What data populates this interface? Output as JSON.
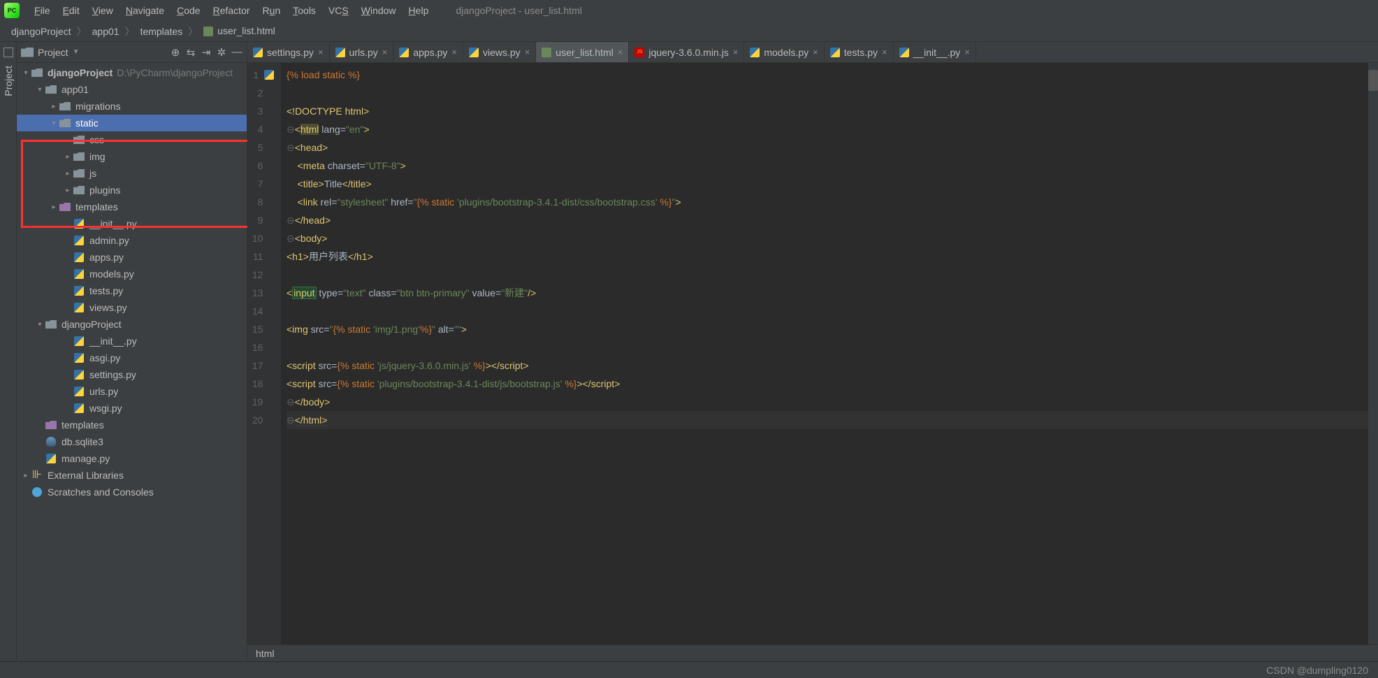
{
  "window_title": "djangoProject - user_list.html",
  "menus": [
    "File",
    "Edit",
    "View",
    "Navigate",
    "Code",
    "Refactor",
    "Run",
    "Tools",
    "VCS",
    "Window",
    "Help"
  ],
  "breadcrumbs": [
    "djangoProject",
    "app01",
    "templates",
    "user_list.html"
  ],
  "project_panel": {
    "title": "Project"
  },
  "tree": {
    "root": {
      "name": "djangoProject",
      "path": "D:\\PyCharm\\djangoProject"
    },
    "app01": "app01",
    "migrations": "migrations",
    "static": "static",
    "static_children": [
      "css",
      "img",
      "js",
      "plugins"
    ],
    "templates_inner": "templates",
    "app_files": [
      "__init__.py",
      "admin.py",
      "apps.py",
      "models.py",
      "tests.py",
      "views.py"
    ],
    "proj_pkg": "djangoProject",
    "proj_files": [
      "__init__.py",
      "asgi.py",
      "settings.py",
      "urls.py",
      "wsgi.py"
    ],
    "templates_top": "templates",
    "db": "db.sqlite3",
    "manage": "manage.py",
    "ext_lib": "External Libraries",
    "scratch": "Scratches and Consoles"
  },
  "tabs": [
    {
      "label": "settings.py",
      "type": "py"
    },
    {
      "label": "urls.py",
      "type": "py"
    },
    {
      "label": "apps.py",
      "type": "py"
    },
    {
      "label": "views.py",
      "type": "py"
    },
    {
      "label": "user_list.html",
      "type": "html",
      "active": true
    },
    {
      "label": "jquery-3.6.0.min.js",
      "type": "js"
    },
    {
      "label": "models.py",
      "type": "py"
    },
    {
      "label": "tests.py",
      "type": "py"
    },
    {
      "label": "__init__.py",
      "type": "py"
    }
  ],
  "code": {
    "l1": "{% load static %}",
    "l3": "<!DOCTYPE html>",
    "l4_a": "<",
    "l4_tag": "html",
    "l4_b": " lang=",
    "l4_str": "\"en\"",
    "l4_c": ">",
    "l5": "<head>",
    "l6_a": "    <",
    "l6_tag": "meta",
    "l6_b": " charset=",
    "l6_str": "\"UTF-8\"",
    "l6_c": ">",
    "l7_a": "    <",
    "l7_tag": "title",
    "l7_b": ">Title</",
    "l7_tag2": "title",
    "l7_c": ">",
    "l8_a": "    <",
    "l8_tag": "link",
    "l8_b": " rel=",
    "l8_s1": "\"stylesheet\"",
    "l8_c": " href=",
    "l8_s2": "\"{% static ",
    "l8_s3": "'plugins/bootstrap-3.4.1-dist/css/bootstrap.css' ",
    "l8_s4": "%}\"",
    "l8_d": ">",
    "l9": "</head>",
    "l10": "<body>",
    "l11_a": "<",
    "l11_tag": "h1",
    "l11_b": ">用户列表</",
    "l11_tag2": "h1",
    "l11_c": ">",
    "l13_a": "<",
    "l13_tag": "input",
    "l13_b": " type=",
    "l13_s1": "\"text\"",
    "l13_c": " class=",
    "l13_s2": "\"btn btn-primary\"",
    "l13_d": " value=",
    "l13_s3": "\"新建\"",
    "l13_e": "/>",
    "l15_a": "<",
    "l15_tag": "img",
    "l15_b": " src=",
    "l15_s1": "\"{% static ",
    "l15_s2": "'img/1.png'",
    "l15_s3": "%}\"",
    "l15_c": " alt=",
    "l15_s4": "\"\"",
    "l15_d": ">",
    "l17_a": "<",
    "l17_tag": "script",
    "l17_b": " src={% static ",
    "l17_s1": "'js/jquery-3.6.0.min.js'",
    "l17_c": " %}></",
    "l17_tag2": "script",
    "l17_d": ">",
    "l18_a": "<",
    "l18_tag": "script",
    "l18_b": " src={% static ",
    "l18_s1": "'plugins/bootstrap-3.4.1-dist/js/bootstrap.js'",
    "l18_c": " %}></",
    "l18_tag2": "script",
    "l18_d": ">",
    "l19": "</body>",
    "l20": "</html>"
  },
  "editor_crumb": "html",
  "watermark": "CSDN @dumpling0120"
}
